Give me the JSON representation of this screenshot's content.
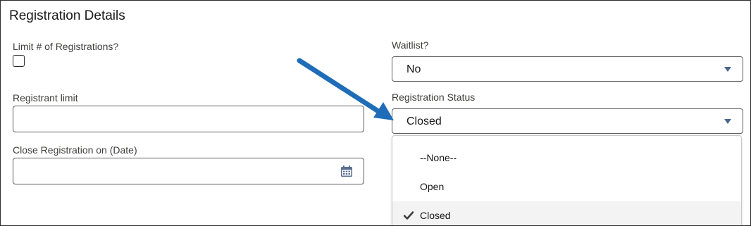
{
  "section": {
    "title": "Registration Details"
  },
  "limit_registrations": {
    "label": "Limit # of Registrations?",
    "checked": false
  },
  "registrant_limit": {
    "label": "Registrant limit",
    "value": ""
  },
  "close_date": {
    "label": "Close Registration on (Date)",
    "value": "",
    "icon": "calendar-icon"
  },
  "waitlist": {
    "label": "Waitlist?",
    "value": "No"
  },
  "registration_status": {
    "label": "Registration Status",
    "value": "Closed",
    "options": [
      {
        "label": "--None--",
        "selected": false
      },
      {
        "label": "Open",
        "selected": false
      },
      {
        "label": "Closed",
        "selected": true
      }
    ]
  },
  "colors": {
    "accent_arrow": "#1f6db8",
    "caret": "#4a6790",
    "selected_option_bg": "#f3f3f3"
  }
}
